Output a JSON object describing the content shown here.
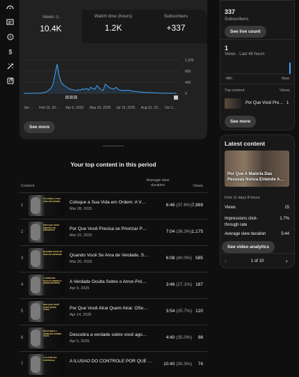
{
  "rail": {
    "icons": [
      "dashboard-icon",
      "content-icon",
      "copyright-icon",
      "monetization-icon",
      "customization-icon",
      "audio-library-icon"
    ]
  },
  "stats": [
    {
      "label": "Views",
      "value": "10.4K"
    },
    {
      "label": "Watch time (hours)",
      "value": "1.2K"
    },
    {
      "label": "Subscribers",
      "value": "+337"
    }
  ],
  "chart_data": {
    "type": "line",
    "x_ticks": [
      "Jan …",
      "Feb 16, 20…",
      "Apr 6, 2025",
      "May 26, 2025",
      "Jul 15, 2025",
      "Aug 31, 20…",
      "Oct 1…"
    ],
    "y_ticks": [
      "1,200",
      "800",
      "400",
      "0"
    ],
    "ylim": [
      0,
      1200
    ],
    "series": [
      {
        "values": [
          0,
          2,
          1,
          3,
          2,
          5,
          4,
          8,
          6,
          20,
          35,
          60,
          120,
          180,
          320,
          700,
          1050,
          620,
          380,
          300,
          250,
          200,
          150,
          140,
          120,
          100,
          130,
          115,
          160,
          140,
          180,
          120,
          220,
          170,
          150,
          280,
          200,
          130,
          110,
          330,
          260,
          200,
          180,
          150,
          220,
          150,
          120,
          100,
          110,
          105,
          120,
          95,
          80,
          70,
          60,
          55,
          40,
          45,
          35,
          30,
          30,
          25,
          20,
          18,
          15,
          12,
          10,
          8,
          6,
          4,
          5,
          3,
          2,
          2
        ]
      }
    ]
  },
  "see_more": "See more",
  "top_content": {
    "title": "Your top content in this period",
    "col_content": "Content",
    "col_avd": "Average view duration",
    "col_views": "Views",
    "rows": [
      {
        "rank": "1",
        "title": "Coloque a Sua Vida em Ordem: A V…",
        "date": "Mar 28, 2025",
        "avd": "6:46",
        "pct": "(37.8%)",
        "views": "7,969",
        "cap": "COLOQUE A SUA VIDA EM ORDEM"
      },
      {
        "rank": "2",
        "title": "Por Que Você Precisa se Priorizar P…",
        "date": "Mar 22, 2025",
        "avd": "7:04",
        "pct": "(36.3%)",
        "views": "1,175",
        "cap": "POR QUE VOCÊ PRECISA SE PRIORIZAR"
      },
      {
        "rank": "3",
        "title": "Quando Você Se Ama de Verdade, S…",
        "date": "Mar 20, 2025",
        "avd": "6:08",
        "pct": "(40.0%)",
        "views": "585",
        "cap": "QUANDO VOCÊ SE AMA DE VERDADE"
      },
      {
        "rank": "4",
        "title": "A Verdade Oculta Sobre o Amor-Pró…",
        "date": "Apr 9, 2025",
        "avd": "3:46",
        "pct": "(27.1%)",
        "views": "187",
        "cap": "A VERDADE OCULTA SOBRE O AMOR-PRÓPRIO"
      },
      {
        "rank": "5",
        "title": "Por Que Você Atrai Quem Atrai: OSe…",
        "date": "Apr 14, 2025",
        "avd": "3:54",
        "pct": "(25.7%)",
        "views": "120",
        "cap": "POR QUE VOCÊ ATRAI QUEM ATRAI"
      },
      {
        "rank": "6",
        "title": "Descubra a verdade sobre você ago…",
        "date": "Apr 5, 2025",
        "avd": "4:40",
        "pct": "(35.0%)",
        "views": "98",
        "cap": "DESCUBRA A VERDADE SOBRE VOCÊ"
      },
      {
        "rank": "7",
        "title": "A ILUSÃO DO CONTROLE POR QUE …",
        "date": "",
        "avd": "10:40",
        "pct": "(30.3%)",
        "views": "74",
        "cap": "A ILUSÃO DO CONTROLE"
      }
    ]
  },
  "side": {
    "subs_count": "337",
    "subs_label": "Subscribers",
    "see_live": "See live count",
    "views48_count": "1",
    "views48_label": "Views · Last 48 hours",
    "h48": "-48h",
    "now": "Now",
    "top_content_label": "Top content",
    "views_label": "Views",
    "top_item": "Por Que Você Pre…",
    "top_item_views": "1",
    "see_more": "See more",
    "latest_title": "Latest content",
    "latest_video": "Por Que A Maioria Das Pessoas Nunca Entende A…",
    "first11": "First 11 days 8 hours",
    "metrics": [
      {
        "label": "Views",
        "value": "15"
      },
      {
        "label": "Impressions click-through rate",
        "value": "1.7%"
      },
      {
        "label": "Average view duration",
        "value": "5:44"
      }
    ],
    "see_analytics": "See video analytics",
    "pager": "1 of 10"
  }
}
